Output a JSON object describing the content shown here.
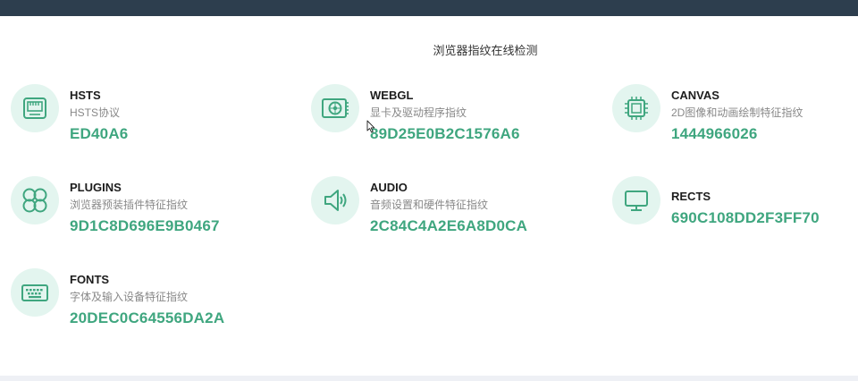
{
  "page": {
    "title": "浏览器指纹在线检测"
  },
  "colors": {
    "accent": "#3fa67f",
    "icon_bg": "#e3f5ef",
    "topbar": "#2d3e4e"
  },
  "items": [
    {
      "name": "HSTS",
      "desc": "HSTS协议",
      "value": "ED40A6",
      "icon": "router-icon"
    },
    {
      "name": "WEBGL",
      "desc": "显卡及驱动程序指纹",
      "value": "89D25E0B2C1576A6",
      "icon": "graphics-card-icon"
    },
    {
      "name": "CANVAS",
      "desc": "2D图像和动画绘制特征指纹",
      "value": "1444966026",
      "icon": "chip-icon"
    },
    {
      "name": "PLUGINS",
      "desc": "浏览器预装插件特征指纹",
      "value": "9D1C8D696E9B0467",
      "icon": "plugins-icon"
    },
    {
      "name": "AUDIO",
      "desc": "音频设置和硬件特征指纹",
      "value": "2C84C4A2E6A8D0CA",
      "icon": "speaker-icon"
    },
    {
      "name": "RECTS",
      "value": "690C108DD2F3FF70",
      "icon": "monitor-icon"
    },
    {
      "name": "FONTS",
      "desc": "字体及输入设备特征指纹",
      "value": "20DEC0C64556DA2A",
      "icon": "keyboard-icon"
    }
  ]
}
